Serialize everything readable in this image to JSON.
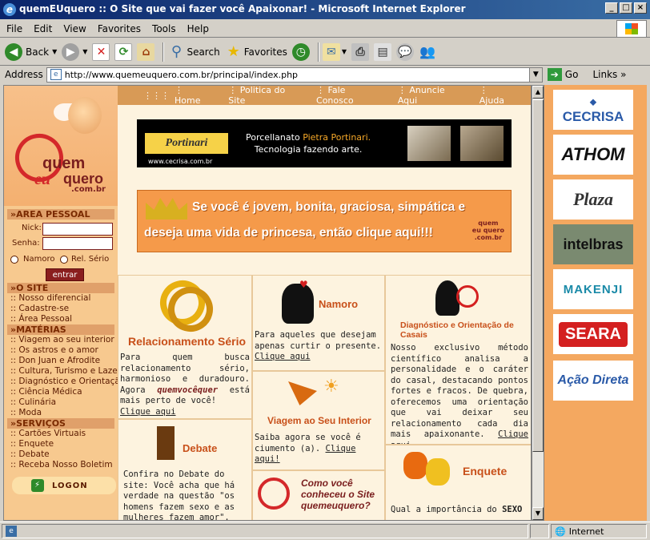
{
  "window": {
    "title": "quemEUquero :: O Site que vai fazer você Apaixonar! - Microsoft Internet Explorer"
  },
  "menu": [
    "File",
    "Edit",
    "View",
    "Favorites",
    "Tools",
    "Help"
  ],
  "toolbar": {
    "back": "Back",
    "search": "Search",
    "favorites": "Favorites"
  },
  "address": {
    "label": "Address",
    "url": "http://www.quemeuquero.com.br/principal/index.php",
    "go": "Go",
    "links": "Links"
  },
  "status": {
    "zone": "Internet"
  },
  "site": {
    "brand": {
      "line1": "quem",
      "line2": "eu",
      "line3": "quero",
      "domain": ".com.br"
    },
    "topnav": [
      "Home",
      "Politica do Site",
      "Fale Conosco",
      "Anuncie Aqui",
      "Ajuda"
    ],
    "area_pessoal": {
      "header": "AREA PESSOAL",
      "nick_label": "Nick:",
      "senha_label": "Senha:",
      "radio1": "Namoro",
      "radio2": "Rel. Sério",
      "submit": "entrar"
    },
    "o_site": {
      "header": "O SITE",
      "items": [
        "Nosso diferencial",
        "Cadastre-se",
        "Área Pessoal"
      ]
    },
    "materias": {
      "header": "MATÉRIAS",
      "items": [
        "Viagem ao seu interior",
        "Os astros e o amor",
        "Don Juan e Afrodite",
        "Cultura, Turismo e Lazer",
        "Diagnóstico e Orientação",
        "Ciência Médica",
        "Culinária",
        "Moda"
      ]
    },
    "servicos": {
      "header": "SERVIÇOS",
      "items": [
        "Cartões Virtuais",
        "Enquete",
        "Debate",
        "Receba Nosso Boletim"
      ]
    },
    "logon": "LOGON",
    "cecrisa": {
      "brand": "Portinari",
      "url": "www.cecrisa.com.br",
      "text1": "Porcellanato ",
      "highlight": "Pietra Portinari.",
      "text2": "Tecnologia fazendo arte."
    },
    "princess": {
      "line1": "Se você é jovem, bonita, graciosa, simpática e",
      "line2": "deseja uma vida de princesa, então clique aqui!!!"
    },
    "relacionamento": {
      "title": "Relacionamento Sério",
      "text": "Para quem busca relacionamento sério, harmonioso e duradouro. Agora",
      "brand": "quemvocêquer",
      "text2": "está mais perto de você!",
      "link": "Clique aqui"
    },
    "namoro": {
      "title": "Namoro",
      "text": "Para aqueles que desejam apenas curtir o presente.",
      "link": "Clique aqui"
    },
    "diagnostico": {
      "title": "Diagnóstico e Orientação de Casais",
      "text": "Nosso exclusivo método científico analisa a personalidade e o caráter do casal, destacando pontos fortes e fracos. De quebra, oferecemos uma orientação que vai deixar seu relacionamento cada dia mais apaixonante.",
      "link": "Clique aqui"
    },
    "viagem": {
      "title": "Viagem ao Seu Interior",
      "text": "Saiba agora se você é ciumento (a).",
      "link": "Clique aqui!"
    },
    "debate": {
      "title": "Debate",
      "text": "Confira no Debate do site: Você acha que há verdade na questão \"os homens fazem sexo e as mulheres fazem amor\"."
    },
    "como": {
      "text": "Como você conheceu o Site quemeuquero?"
    },
    "enquete": {
      "title": "Enquete",
      "text": "Qual a importância do",
      "bold": "SEXO"
    },
    "sponsors": [
      "CECRISA",
      "ATHOM",
      "Plaza",
      "intelbras",
      "MAKENJI",
      "SEARA",
      "Ação Direta"
    ]
  }
}
